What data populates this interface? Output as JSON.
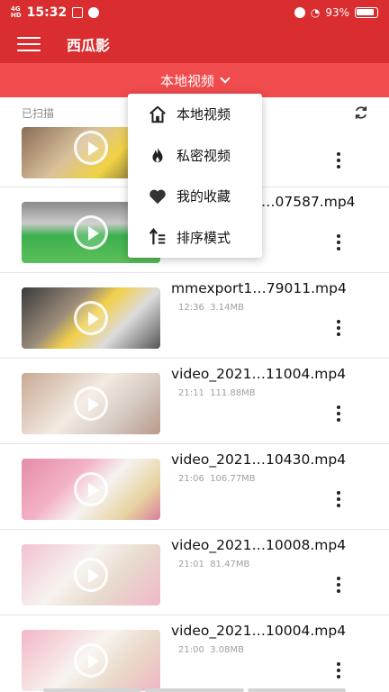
{
  "status": {
    "network": "4G HD",
    "time": "15:32",
    "battery": "93%"
  },
  "app": {
    "title": "西瓜影"
  },
  "tab": {
    "label": "本地视频"
  },
  "scan": {
    "label": "已扫描"
  },
  "menu": [
    {
      "label": "本地视频",
      "icon": "home-icon"
    },
    {
      "label": "私密视频",
      "icon": "fire-icon"
    },
    {
      "label": "我的收藏",
      "icon": "heart-icon"
    },
    {
      "label": "排序模式",
      "icon": "sort-icon"
    }
  ],
  "videos": [
    {
      "name": "",
      "time": "",
      "size": ""
    },
    {
      "name": "…07587.mp4",
      "time": "",
      "size": ""
    },
    {
      "name": "mmexport1…79011.mp4",
      "time": "12:36",
      "size": "3.14MB"
    },
    {
      "name": "video_2021…11004.mp4",
      "time": "21:11",
      "size": "111.88MB"
    },
    {
      "name": "video_2021…10430.mp4",
      "time": "21:06",
      "size": "106.77MB"
    },
    {
      "name": "video_2021…10008.mp4",
      "time": "21:01",
      "size": "81.47MB"
    },
    {
      "name": "video_2021…10004.mp4",
      "time": "21:00",
      "size": "3.08MB"
    }
  ]
}
